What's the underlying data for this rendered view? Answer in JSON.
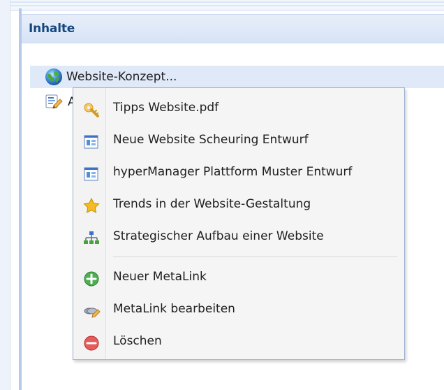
{
  "panel": {
    "title": "Inhalte"
  },
  "tree": {
    "items": [
      {
        "label": "Website-Konzept...",
        "icon": "globe-icon"
      },
      {
        "label": "A",
        "icon": "document-edit-icon"
      }
    ]
  },
  "context_menu": {
    "items": [
      {
        "label": "Tipps Website.pdf",
        "icon": "key-icon"
      },
      {
        "label": "Neue Website Scheuring Entwurf",
        "icon": "layout-icon"
      },
      {
        "label": "hyperManager Plattform Muster Entwurf",
        "icon": "layout-icon"
      },
      {
        "label": "Trends in der Website-Gestaltung",
        "icon": "star-icon"
      },
      {
        "label": "Strategischer Aufbau einer Website",
        "icon": "sitemap-icon"
      },
      {
        "label": "Neuer MetaLink",
        "icon": "add-icon"
      },
      {
        "label": "MetaLink bearbeiten",
        "icon": "edit-icon"
      },
      {
        "label": "Löschen",
        "icon": "delete-icon"
      }
    ]
  },
  "colors": {
    "header_text": "#16477f",
    "header_background": "#dbe6f7",
    "selection_background": "#dfe9f8",
    "menu_background": "#f5f5f5",
    "menu_border": "#9fb2cf"
  }
}
